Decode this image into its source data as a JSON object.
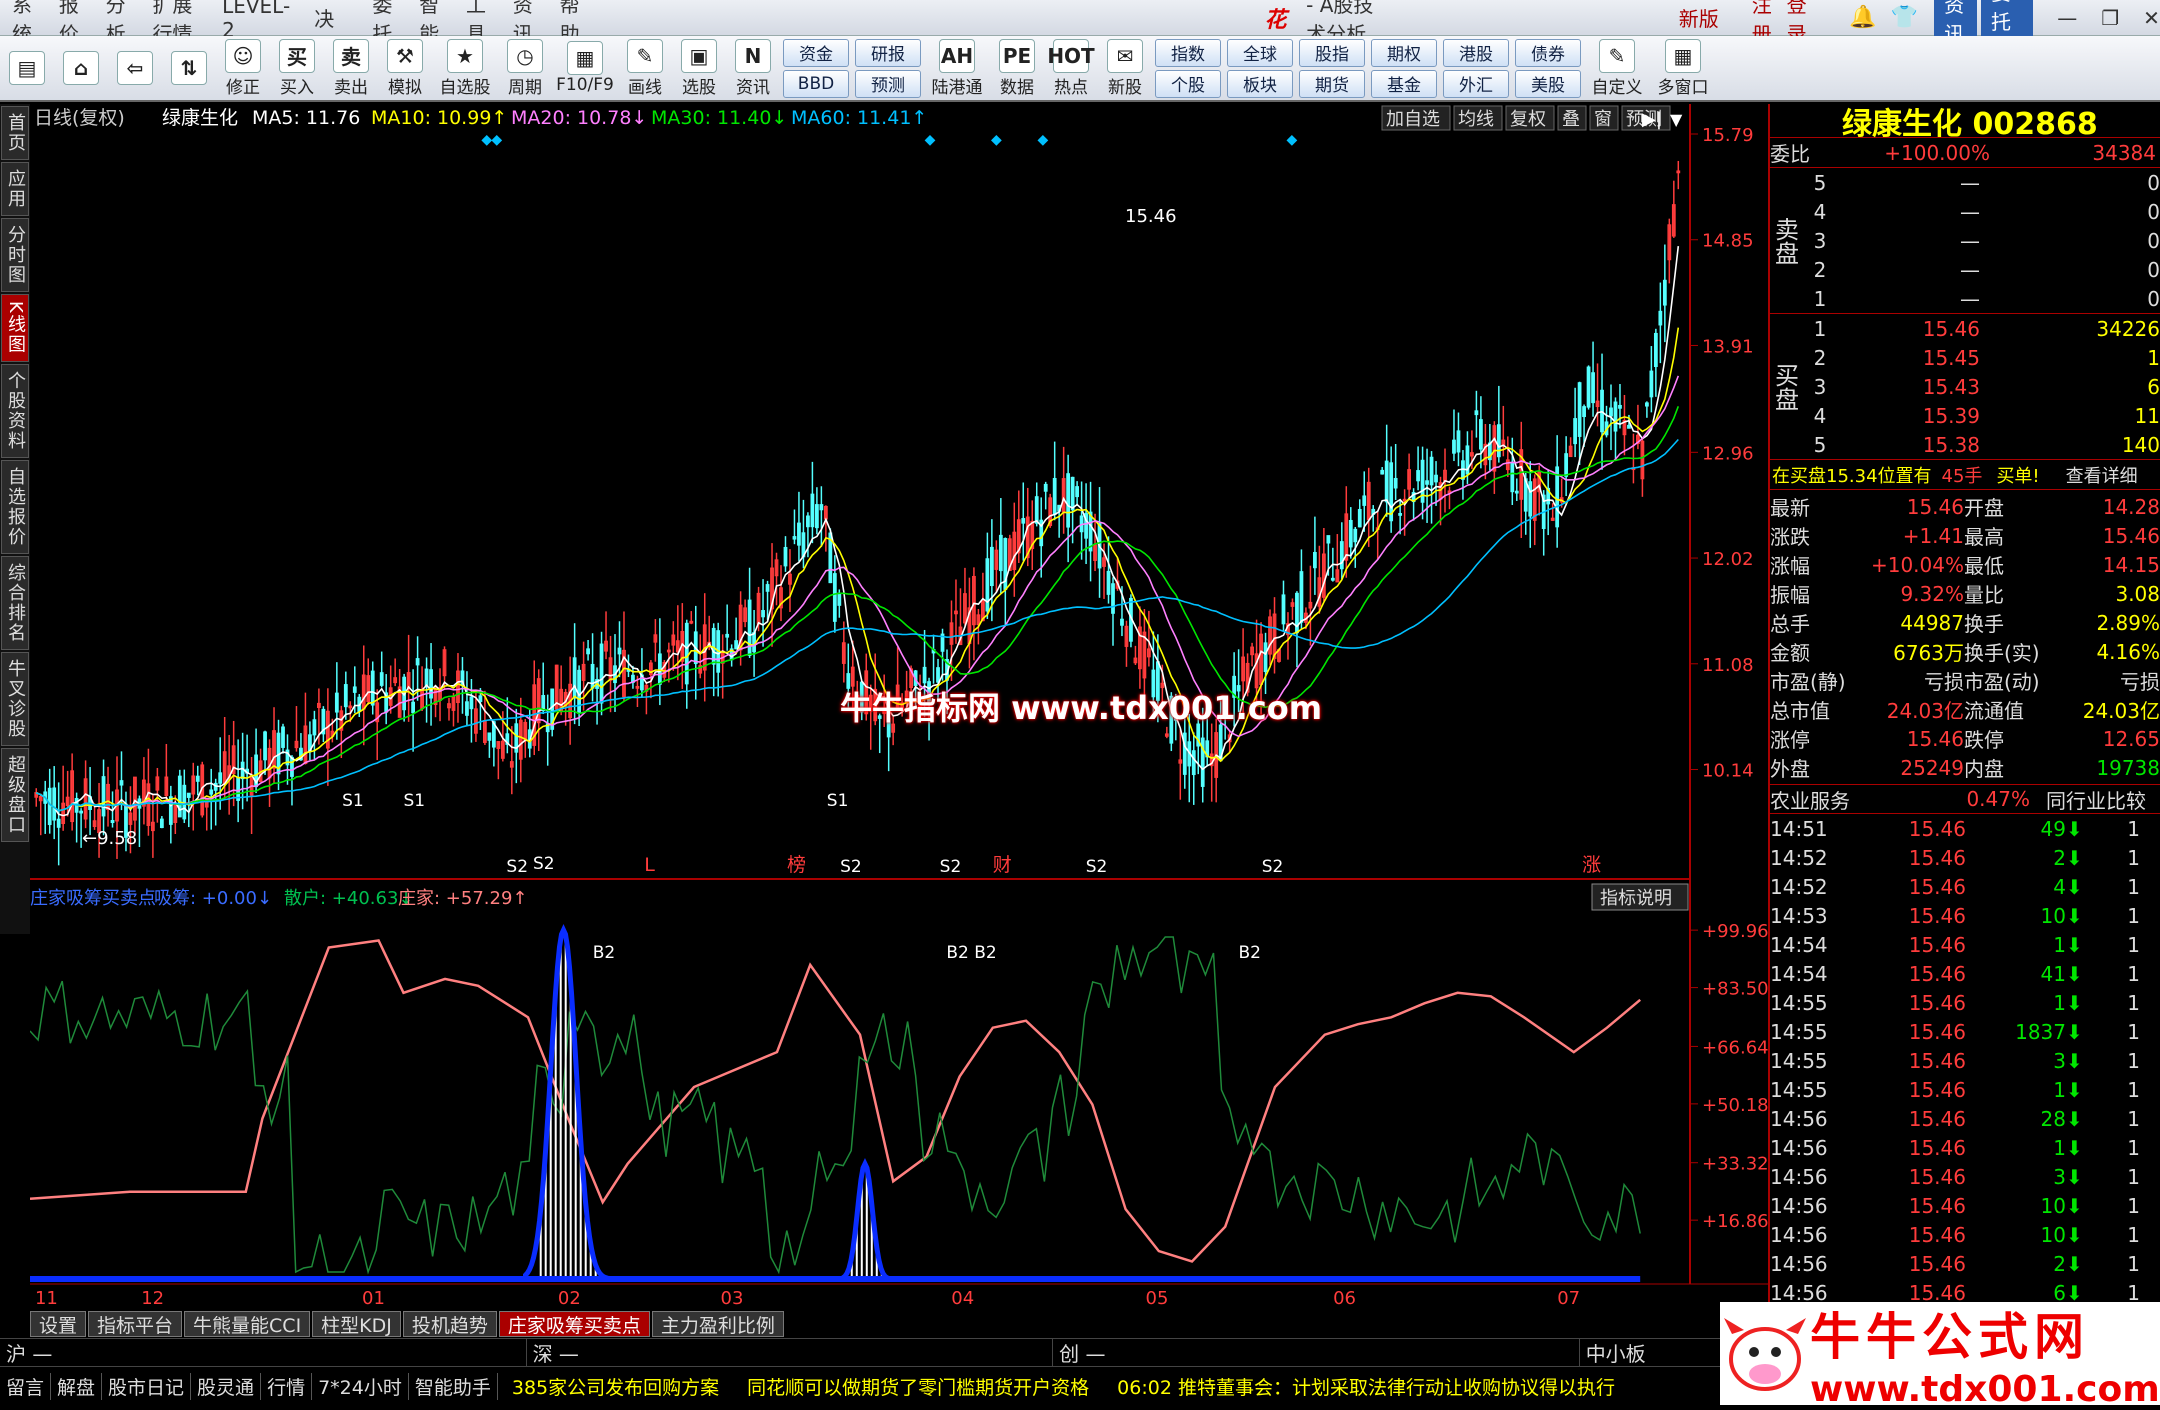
{
  "menu": [
    "系统",
    "报价",
    "分析",
    "扩展行情",
    "LEVEL-2",
    "云决策",
    "委托",
    "智能",
    "工具",
    "资讯",
    "帮助"
  ],
  "menu_brand": "同花顺",
  "menu_title": "- A股技术分析",
  "menu_right": {
    "new": "发现新版本",
    "register": "注册",
    "login": "登录",
    "news": "资讯",
    "trade": "委托"
  },
  "toolbar": [
    {
      "icon": "▤",
      "label": ""
    },
    {
      "icon": "⌂",
      "label": ""
    },
    {
      "icon": "⇦",
      "label": ""
    },
    {
      "icon": "⇅",
      "label": ""
    },
    {
      "icon": "☺",
      "label": "修正"
    },
    {
      "icon": "买",
      "label": "买入"
    },
    {
      "icon": "卖",
      "label": "卖出"
    },
    {
      "icon": "⚒",
      "label": "模拟"
    },
    {
      "icon": "★",
      "label": "自选股"
    },
    {
      "icon": "◷",
      "label": "周期"
    },
    {
      "icon": "▦",
      "label": "F10/F9"
    },
    {
      "icon": "✎",
      "label": "画线"
    },
    {
      "icon": "▣",
      "label": "选股"
    },
    {
      "icon": "N",
      "label": "资讯"
    }
  ],
  "toolbar2": [
    [
      "资金",
      "BBD"
    ],
    [
      "研报",
      "预测"
    ]
  ],
  "toolbar3": [
    {
      "icon": "AH",
      "label": "陆港通"
    },
    {
      "icon": "PE",
      "label": "数据"
    },
    {
      "icon": "HOT",
      "label": "热点"
    },
    {
      "icon": "✉",
      "label": "新股"
    }
  ],
  "toolbar4": [
    [
      "指数",
      "个股"
    ],
    [
      "全球",
      "板块"
    ],
    [
      "股指",
      "期货"
    ],
    [
      "期权",
      "基金"
    ],
    [
      "港股",
      "外汇"
    ],
    [
      "债券",
      "美股"
    ]
  ],
  "toolbar5": [
    {
      "icon": "✎",
      "label": "自定义"
    },
    {
      "icon": "▦",
      "label": "多窗口"
    }
  ],
  "sidebar": [
    "首页",
    "应用",
    "分时图",
    "K线图",
    "个股资料",
    "自选报价",
    "综合排名",
    "牛叉诊股",
    "超级盘口"
  ],
  "kline_header": {
    "period": "日线(复权)",
    "name": "绿康生化",
    "ma5": "MA5: 11.76",
    "ma10": "MA10: 10.99↑",
    "ma20": "MA20: 10.78↓",
    "ma30": "MA30: 11.40↓",
    "ma60": "MA60: 11.41↑"
  },
  "kline_buttons": [
    "加自选",
    "均线",
    "复权",
    "叠",
    "窗",
    "预测"
  ],
  "price_axis": [
    "15.79",
    "14.85",
    "13.91",
    "12.96",
    "12.02",
    "11.08",
    "10.14"
  ],
  "high_label": "15.46",
  "low_label": "←9.58",
  "markers": [
    {
      "t": "L",
      "x": 0.37
    },
    {
      "t": "榜",
      "x": 0.456
    },
    {
      "t": "财",
      "x": 0.58
    },
    {
      "t": "涨",
      "x": 0.935
    }
  ],
  "ind_header": {
    "name": "庄家吸筹买卖点",
    "v1": "吸筹: +0.00↓",
    "v2": "散户: +40.63↓",
    "v3": "庄家: +57.29↑"
  },
  "ind_help": "指标说明",
  "ind_axis": [
    "+99.96",
    "+83.50",
    "+66.64",
    "+50.18",
    "+33.32",
    "+16.86"
  ],
  "date_axis": [
    [
      "11",
      0.003
    ],
    [
      "12",
      0.067
    ],
    [
      "01",
      0.2
    ],
    [
      "02",
      0.318
    ],
    [
      "03",
      0.416
    ],
    [
      "04",
      0.555
    ],
    [
      "05",
      0.672
    ],
    [
      "06",
      0.785
    ],
    [
      "07",
      0.92
    ]
  ],
  "signals": [
    [
      "S1",
      0.188,
      702
    ],
    [
      "S1",
      0.225,
      702
    ],
    [
      "S2",
      0.287,
      768
    ],
    [
      "S2",
      0.303,
      765
    ],
    [
      "B2",
      0.339,
      854
    ],
    [
      "S1",
      0.48,
      702
    ],
    [
      "S2",
      0.488,
      768
    ],
    [
      "S2",
      0.548,
      768
    ],
    [
      "B2 B2",
      0.552,
      854
    ],
    [
      "S2",
      0.636,
      768
    ],
    [
      "B2",
      0.728,
      854
    ],
    [
      "S2",
      0.742,
      768
    ]
  ],
  "tabs": [
    "设置",
    "指标平台",
    "牛熊量能CCI",
    "柱型KDJ",
    "投机趋势",
    "庄家吸筹买卖点",
    "主力盈利比例"
  ],
  "active_tab": "庄家吸筹买卖点",
  "index_bar": [
    "沪",
    "深",
    "创",
    "中小板"
  ],
  "right": {
    "title": "绿康生化 002868",
    "wb": {
      "label": "委比",
      "value": "+100.00%",
      "num": "34384"
    },
    "sell": [
      [
        "5",
        "—",
        "0"
      ],
      [
        "4",
        "—",
        "0"
      ],
      [
        "3",
        "—",
        "0"
      ],
      [
        "2",
        "—",
        "0"
      ],
      [
        "1",
        "—",
        "0"
      ]
    ],
    "buy": [
      [
        "1",
        "15.46",
        "34226"
      ],
      [
        "2",
        "15.45",
        "1"
      ],
      [
        "3",
        "15.43",
        "6"
      ],
      [
        "4",
        "15.39",
        "11"
      ],
      [
        "5",
        "15.38",
        "140"
      ]
    ],
    "sell_label": "卖盘",
    "buy_label": "买盘",
    "bid_note": {
      "text": "在买盘15.34位置有",
      "hands": "45手",
      "action": "买单!",
      "link": "查看详细"
    },
    "stats": [
      [
        "最新",
        "15.46",
        "开盘",
        "14.28"
      ],
      [
        "涨跌",
        "+1.41",
        "最高",
        "15.46"
      ],
      [
        "涨幅",
        "+10.04%",
        "最低",
        "14.15"
      ],
      [
        "振幅",
        "9.32%",
        "量比",
        "3.08"
      ],
      [
        "总手",
        "44987",
        "换手",
        "2.89%"
      ],
      [
        "金额",
        "6763万",
        "换手(实)",
        "4.16%"
      ],
      [
        "市盈(静)",
        "亏损",
        "市盈(动)",
        "亏损"
      ],
      [
        "总市值",
        "24.03亿",
        "流通值",
        "24.03亿"
      ],
      [
        "涨停",
        "15.46",
        "跌停",
        "12.65"
      ],
      [
        "外盘",
        "25249",
        "内盘",
        "19738"
      ]
    ],
    "sector": {
      "name": "农业服务",
      "pct": "0.47%",
      "btn": "同行业比较"
    },
    "ticks": [
      [
        "14:51",
        "15.46",
        "49"
      ],
      [
        "14:52",
        "15.46",
        "2"
      ],
      [
        "14:52",
        "15.46",
        "4"
      ],
      [
        "14:53",
        "15.46",
        "10"
      ],
      [
        "14:54",
        "15.46",
        "1"
      ],
      [
        "14:54",
        "15.46",
        "41"
      ],
      [
        "14:55",
        "15.46",
        "1"
      ],
      [
        "14:55",
        "15.46",
        "1837"
      ],
      [
        "14:55",
        "15.46",
        "3"
      ],
      [
        "14:55",
        "15.46",
        "1"
      ],
      [
        "14:56",
        "15.46",
        "28"
      ],
      [
        "14:56",
        "15.46",
        "1"
      ],
      [
        "14:56",
        "15.46",
        "3"
      ],
      [
        "14:56",
        "15.46",
        "10"
      ],
      [
        "14:56",
        "15.46",
        "10"
      ],
      [
        "14:56",
        "15.46",
        "2"
      ],
      [
        "14:56",
        "15.46",
        "6"
      ]
    ]
  },
  "status": {
    "items": [
      "留言",
      "解盘",
      "股市日记",
      "股灵通",
      "行情",
      "7*24小时",
      "智能助手"
    ],
    "news": [
      "385家公司发布回购方案",
      "同花顺可以做期货了零门槛期货开户资格",
      "06:02 推特董事会：计划采取法律行动让收购协议得以执行"
    ]
  },
  "watermark": "牛牛指标网 www.tdx001.com",
  "logo": {
    "cn": "牛牛公式网",
    "url": "www.tdx001.com"
  },
  "colors": {
    "up": "#ff3c3c",
    "down": "#54ffff",
    "ma5": "#ffffff",
    "ma10": "#ffff00",
    "ma20": "#ff80ff",
    "ma30": "#00e600",
    "ma60": "#00c0ff"
  }
}
